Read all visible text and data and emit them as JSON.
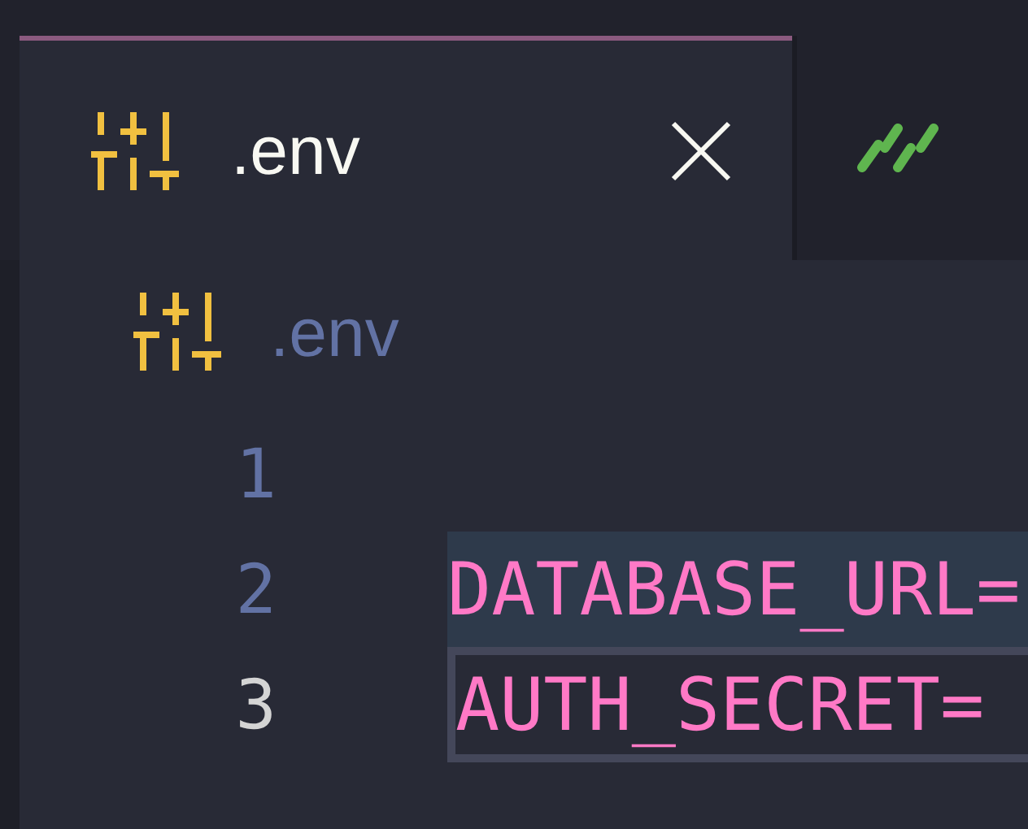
{
  "tabs": [
    {
      "label": ".env",
      "selected": true,
      "kind": "env",
      "closable": true
    },
    {
      "selected": false,
      "kind": "shell",
      "closable": false
    }
  ],
  "breadcrumb": {
    "label": ".env",
    "kind": "env"
  },
  "editor": {
    "lines": [
      {
        "number": "1",
        "highlighted": false,
        "current": false
      },
      {
        "number": "2",
        "tokens": [
          {
            "kind": "key",
            "text": "DATABASE_URL="
          }
        ],
        "highlighted": true,
        "current": false
      },
      {
        "number": "3",
        "tokens": [
          {
            "kind": "key",
            "text": "AUTH_SECRET="
          }
        ],
        "highlighted": false,
        "current": true
      }
    ]
  }
}
